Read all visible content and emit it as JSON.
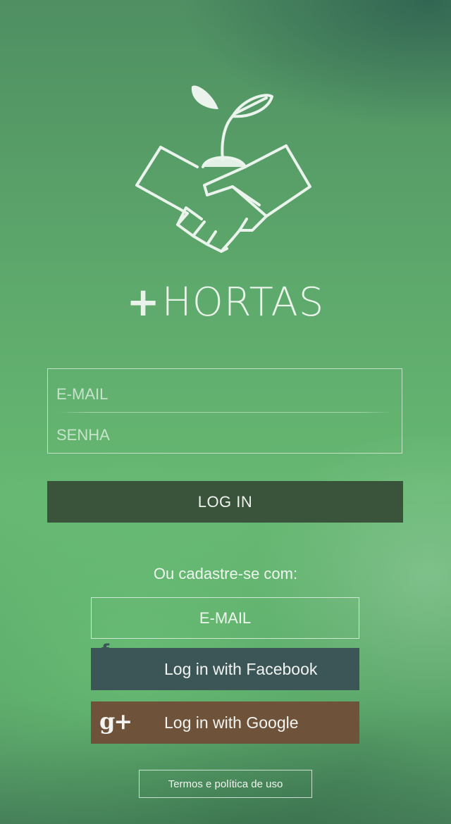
{
  "app": {
    "brand_plus": "+",
    "brand_name": "HORTAS"
  },
  "login_form": {
    "email_placeholder": "E-MAIL",
    "password_placeholder": "SENHA",
    "login_button": "LOG IN"
  },
  "signup": {
    "prompt": "Ou cadastre-se com:",
    "email_button": "E-MAIL",
    "facebook_button": "Log in with Facebook",
    "google_button": "Log in with Google",
    "google_icon_text": "g+"
  },
  "footer": {
    "terms_link": "Termos e política de uso"
  },
  "icons": {
    "logo": "handshake-sprout-icon",
    "facebook": "facebook-icon",
    "google": "google-plus-icon"
  },
  "colors": {
    "login_button": "#3a543c",
    "facebook_button": "#3c5658",
    "google_button": "#6e5239",
    "background": "#5ea96c"
  }
}
